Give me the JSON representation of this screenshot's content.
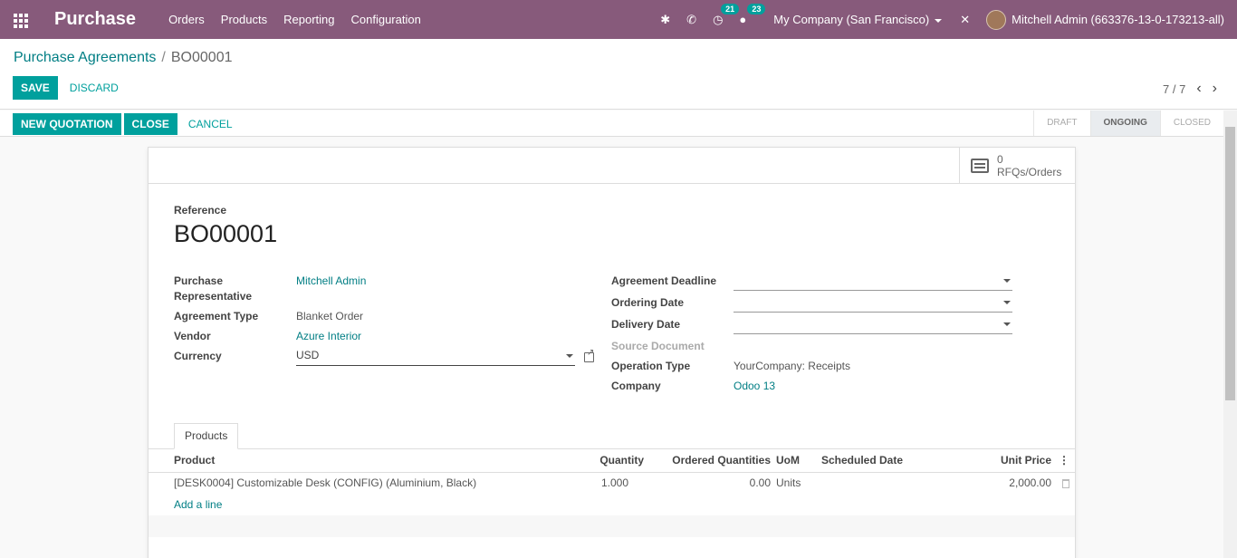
{
  "navbar": {
    "app_name": "Purchase",
    "menu": [
      "Orders",
      "Products",
      "Reporting",
      "Configuration"
    ],
    "activity_count": "21",
    "messages_count": "23",
    "company": "My Company (San Francisco)",
    "user": "Mitchell Admin (663376-13-0-173213-all)"
  },
  "breadcrumb": {
    "parent": "Purchase Agreements",
    "separator": "/",
    "current": "BO00001"
  },
  "actions": {
    "save": "SAVE",
    "discard": "DISCARD",
    "pager": "7 / 7"
  },
  "status_buttons": {
    "new_quotation": "NEW QUOTATION",
    "close": "CLOSE",
    "cancel": "CANCEL"
  },
  "stages": [
    "DRAFT",
    "ONGOING",
    "CLOSED"
  ],
  "active_stage": "ONGOING",
  "smart_button": {
    "count": "0",
    "label": "RFQs/Orders"
  },
  "form": {
    "reference_label": "Reference",
    "reference": "BO00001",
    "purchase_rep_label": "Purchase Representative",
    "purchase_rep": "Mitchell Admin",
    "agreement_type_label": "Agreement Type",
    "agreement_type": "Blanket Order",
    "vendor_label": "Vendor",
    "vendor": "Azure Interior",
    "currency_label": "Currency",
    "currency": "USD",
    "deadline_label": "Agreement Deadline",
    "deadline": "",
    "ordering_date_label": "Ordering Date",
    "ordering_date": "",
    "delivery_date_label": "Delivery Date",
    "delivery_date": "",
    "source_doc_label": "Source Document",
    "operation_type_label": "Operation Type",
    "operation_type": "YourCompany: Receipts",
    "company_label": "Company",
    "company": "Odoo 13"
  },
  "tabs": [
    "Products"
  ],
  "lines_table": {
    "headers": [
      "Product",
      "Quantity",
      "Ordered Quantities",
      "UoM",
      "Scheduled Date",
      "Unit Price"
    ],
    "rows": [
      {
        "product": "[DESK0004] Customizable Desk (CONFIG) (Aluminium, Black)",
        "quantity": "1.000",
        "ordered": "0.00",
        "uom": "Units",
        "scheduled": "",
        "price": "2,000.00"
      }
    ],
    "add_line": "Add a line"
  },
  "colors": {
    "navbar": "#875a7b",
    "primary": "#00a09d",
    "link": "#017e84"
  },
  "icons": [
    "apps-grid-icon",
    "bug-icon",
    "phone-icon",
    "activity-clock-icon",
    "chat-icon",
    "close-x-icon",
    "chevron-left-icon",
    "chevron-right-icon",
    "rfq-list-icon",
    "external-link-icon",
    "trash-icon",
    "column-options-icon"
  ]
}
